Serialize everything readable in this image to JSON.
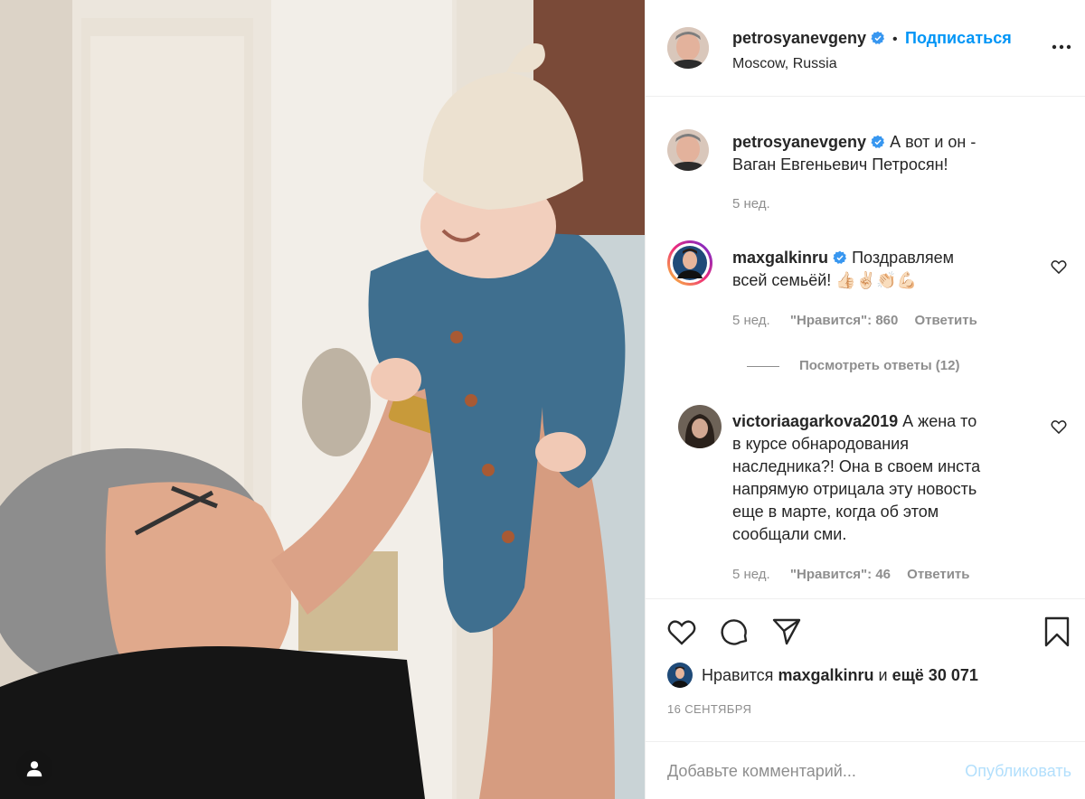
{
  "post": {
    "author": {
      "username": "petrosyanevgeny",
      "follow_label": "Подписаться",
      "separator": "•",
      "location": "Moscow, Russia"
    },
    "caption": {
      "username": "petrosyanevgeny",
      "text_line1": "А вот и он -",
      "text_line2": "Ваган Евгеньевич Петросян!",
      "time": "5 нед."
    },
    "comments": [
      {
        "username": "maxgalkinru",
        "text_line1": "Поздравляем",
        "text_line2": "всей семьёй! 👍🏻✌🏻👏🏻💪🏻",
        "time": "5 нед.",
        "likes": "\"Нравится\": 860",
        "reply": "Ответить",
        "view_replies": "Посмотреть ответы (12)"
      },
      {
        "username": "victoriaagarkova2019",
        "text_line1": "А жена то",
        "text_lines": [
          "в курсе обнародования",
          "наследника?! Она в своем инста",
          "напрямую отрицала эту новость",
          "еще в марте, когда об этом",
          "сообщали сми."
        ],
        "time": "5 нед.",
        "likes": "\"Нравится\": 46",
        "reply": "Ответить"
      }
    ],
    "likes_line": {
      "prefix": "Нравится",
      "user": "maxgalkinru",
      "middle": "и",
      "rest": "ещё 30 071"
    },
    "date": "16 СЕНТЯБРЯ",
    "add_comment_placeholder": "Добавьте комментарий...",
    "publish_label": "Опубликовать"
  },
  "colors": {
    "accent": "#0095f6",
    "muted": "#8e8e8e",
    "publish_disabled": "#b2dffc",
    "verified": "#3897f0"
  },
  "icons": [
    "more-icon",
    "verified-icon",
    "heart-icon",
    "comment-icon",
    "share-icon",
    "bookmark-icon",
    "user-tag-icon"
  ]
}
